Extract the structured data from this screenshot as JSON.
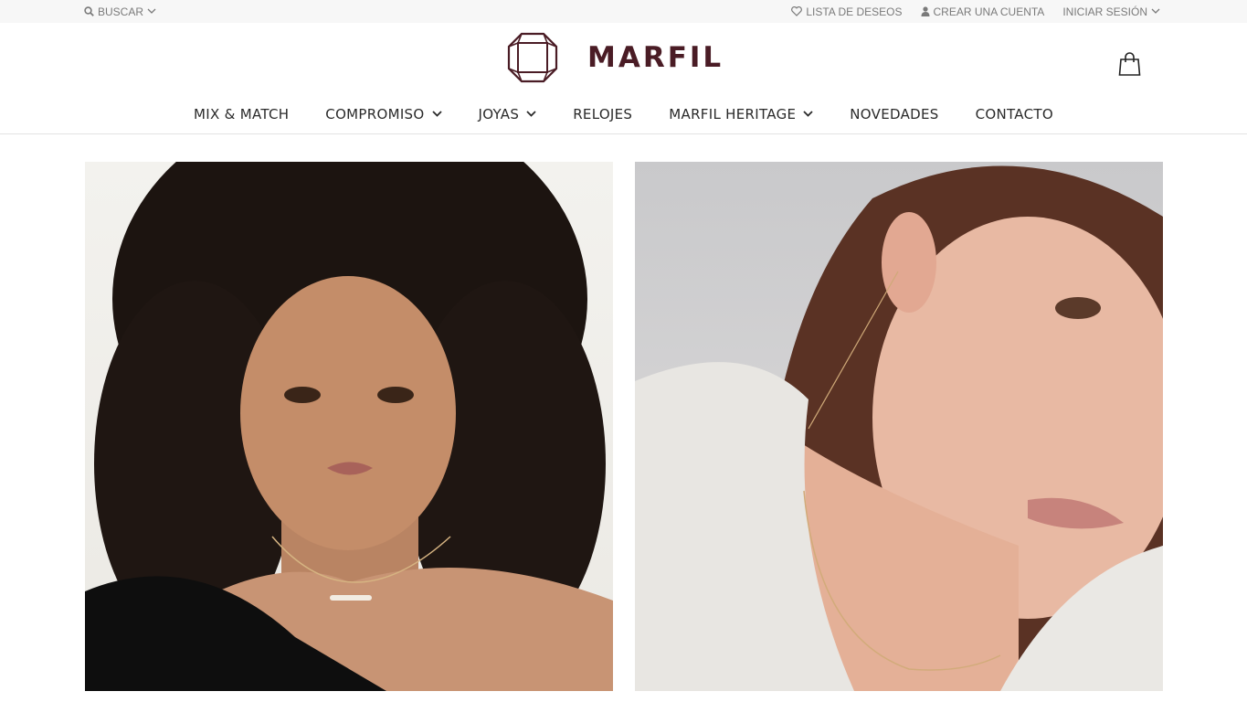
{
  "topbar": {
    "search_label": "BUSCAR",
    "wishlist_label": "LISTA DE DESEOS",
    "create_account_label": "CREAR UNA CUENTA",
    "login_label": "INICIAR SESIÓN"
  },
  "brand": {
    "name": "MARFIL",
    "color": "#4a1c25"
  },
  "nav": {
    "items": [
      {
        "label": "MIX & MATCH"
      },
      {
        "label": "COMPROMISO"
      },
      {
        "label": "JOYAS"
      },
      {
        "label": "RELOJES"
      },
      {
        "label": "MARFIL HERITAGE"
      },
      {
        "label": "NOVEDADES"
      },
      {
        "label": "CONTACTO"
      }
    ]
  },
  "icons": {
    "search": "search-icon",
    "heart": "heart-icon",
    "user": "user-icon",
    "chevron": "chevron-down-icon",
    "cart": "shopping-bag-icon",
    "logo": "gem-logo-icon"
  },
  "colors": {
    "topbar_bg": "#f7f7f7",
    "text": "#2a2a2a",
    "muted": "#7a7a7a"
  }
}
